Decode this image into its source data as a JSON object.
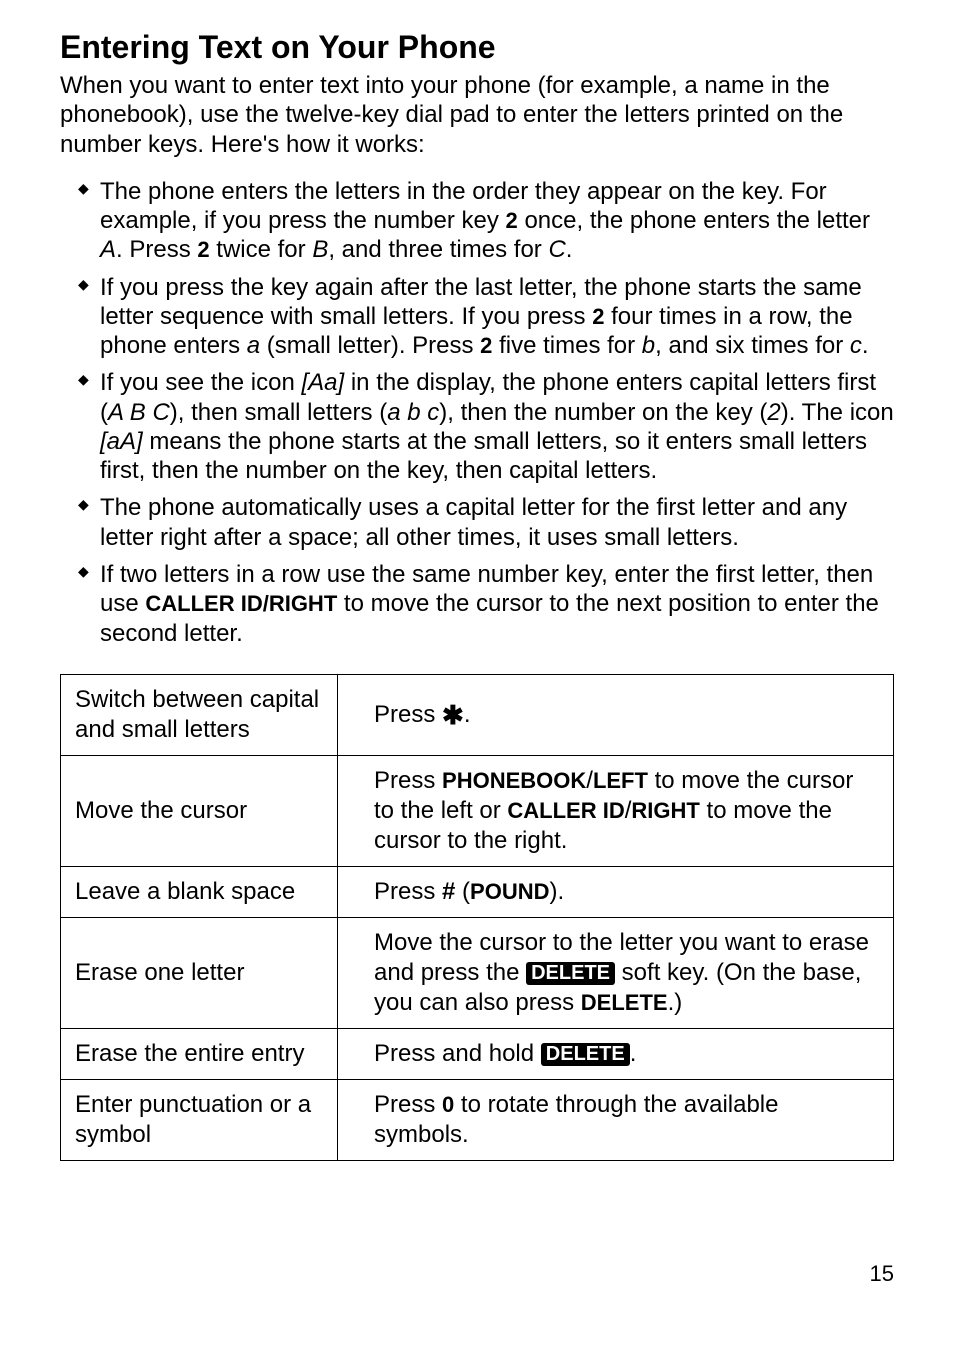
{
  "title": "Entering Text on Your Phone",
  "intro": "When you want to enter text into your phone (for example, a name in the phonebook), use the twelve-key dial pad to enter the letters printed on the number keys. Here's how it works:",
  "bullets": {
    "b1_a": "The phone enters the letters in the order they appear on the key. For example, if you press the number key ",
    "b1_key1": "2",
    "b1_b": " once, the phone enters the letter ",
    "b1_A": "A",
    "b1_c": ". Press ",
    "b1_key2": "2",
    "b1_d": " twice for ",
    "b1_B": "B",
    "b1_e": ", and three times for ",
    "b1_C": "C",
    "b1_f": ".",
    "b2_a": "If you press the key again after the last letter, the phone starts the same letter sequence with small letters. If you press ",
    "b2_key1": "2",
    "b2_b": " four times in a row, the phone enters ",
    "b2_a_it": "a",
    "b2_c": " (small letter). Press ",
    "b2_key2": "2",
    "b2_d": " five times for ",
    "b2_b_it": "b",
    "b2_e": ", and six times for ",
    "b2_c_it": "c",
    "b2_f": ".",
    "b3_a": "If you see the icon ",
    "b3_icon1": "[Aa]",
    "b3_b": " in the display, the phone enters capital letters first (",
    "b3_ABC": "A B C",
    "b3_c": "), then small letters (",
    "b3_abc": "a b c",
    "b3_d": "), then the number on the key (",
    "b3_2": "2",
    "b3_e": "). The icon ",
    "b3_icon2": "[aA]",
    "b3_f": " means the phone starts at the small letters, so it enters small letters first, then the number on the key, then capital letters.",
    "b4": "The phone automatically uses a capital letter for the first letter and any letter right after a space; all other times, it uses small letters.",
    "b5_a": "If two letters in a row use the same number key, enter the first letter, then use ",
    "b5_key": "CALLER ID/RIGHT",
    "b5_b": " to move the cursor to the next position to enter the second letter."
  },
  "table": {
    "r1_left": "Switch between capital and small letters",
    "r1_press": "Press ",
    "r1_star": "✱",
    "r1_dot": ".",
    "r2_left": "Move the cursor",
    "r2_a": "Press ",
    "r2_k1": "PHONEBOOK",
    "r2_slash1": "/",
    "r2_k2": "LEFT",
    "r2_b": " to move the cursor to the left or ",
    "r2_k3": "CALLER ID",
    "r2_slash2": "/",
    "r2_k4": "RIGHT",
    "r2_c": " to move the cursor to the right.",
    "r3_left": "Leave a blank space",
    "r3_a": "Press ",
    "r3_hash": "#",
    "r3_b": " (",
    "r3_pound": "POUND",
    "r3_c": ").",
    "r4_left": "Erase one letter",
    "r4_a": "Move the cursor to the letter you want to erase and press the ",
    "r4_del": "DELETE",
    "r4_b": " soft key. (On the base, you can also press ",
    "r4_del2": "DELETE",
    "r4_c": ".)",
    "r5_left": "Erase the entire entry",
    "r5_a": "Press and hold ",
    "r5_del": "DELETE",
    "r5_b": ".",
    "r6_left": "Enter punctuation or a symbol",
    "r6_a": "Press ",
    "r6_zero": "0",
    "r6_b": " to rotate through the available symbols."
  },
  "page_number": "15"
}
